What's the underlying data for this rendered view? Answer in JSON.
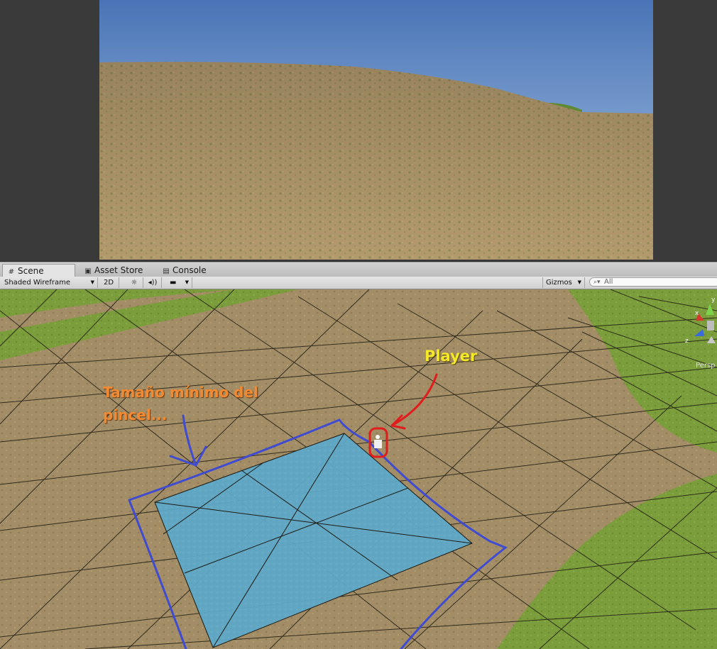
{
  "tabs": [
    {
      "label": "Scene",
      "icon": "hash-icon"
    },
    {
      "label": "Asset Store",
      "icon": "shopping-bag-icon"
    },
    {
      "label": "Console",
      "icon": "console-icon"
    }
  ],
  "toolbar": {
    "shading_mode": "Shaded Wireframe",
    "mode_2d": "2D",
    "gizmos_label": "Gizmos",
    "search_placeholder": "All"
  },
  "scene_gizmo": {
    "axes": [
      "y",
      "x",
      "z"
    ],
    "projection": "Persp"
  },
  "annotations": {
    "player_label": "Player",
    "brush_note": "Tamaño mínimo del pincel..."
  },
  "colors": {
    "sky_top": "#4d77b8",
    "sky_bottom": "#a9c7e6",
    "terrain_sand": "#a68f66",
    "terrain_grass": "#7a9b3c",
    "selection_fill": "#5fa9c9",
    "brush_outline": "#3f4bd0",
    "player_highlight": "#e01d1d",
    "player_label_color": "#f5ea2a",
    "brush_note_color": "#f28a33"
  }
}
